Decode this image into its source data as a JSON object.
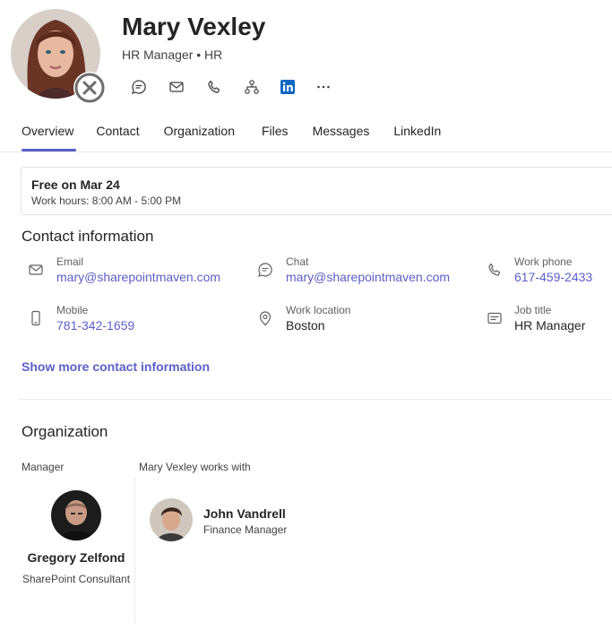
{
  "profile": {
    "name": "Mary Vexley",
    "subtitle": "HR Manager • HR",
    "presence": "offline-icon"
  },
  "actions": [
    {
      "icon": "chat-icon",
      "name": "chat-action-button"
    },
    {
      "icon": "mail-icon",
      "name": "email-action-button"
    },
    {
      "icon": "phone-icon",
      "name": "call-action-button"
    },
    {
      "icon": "org-chart-icon",
      "name": "org-action-button"
    },
    {
      "icon": "linkedin-icon",
      "name": "linkedin-action-button"
    },
    {
      "icon": "more-icon",
      "name": "more-actions-button"
    }
  ],
  "tabs": [
    {
      "label": "Overview",
      "selected": true
    },
    {
      "label": "Contact"
    },
    {
      "label": "Organization"
    },
    {
      "label": "Files"
    },
    {
      "label": "Messages"
    },
    {
      "label": "LinkedIn"
    }
  ],
  "availability": {
    "title": "Free on Mar 24",
    "hours": "Work hours: 8:00 AM - 5:00 PM"
  },
  "contact": {
    "title": "Contact information",
    "email": {
      "label": "Email",
      "value": "mary@sharepointmaven.com",
      "icon": "mail-icon"
    },
    "chat": {
      "label": "Chat",
      "value": "mary@sharepointmaven.com",
      "icon": "chat-icon"
    },
    "work_phone": {
      "label": "Work phone",
      "value": "617-459-2433",
      "icon": "phone-icon"
    },
    "mobile": {
      "label": "Mobile",
      "value": "781-342-1659",
      "icon": "mobile-icon"
    },
    "location": {
      "label": "Work location",
      "value": "Boston",
      "icon": "location-icon"
    },
    "job": {
      "label": "Job title",
      "value": "HR Manager",
      "icon": "id-card-icon"
    },
    "show_more": "Show more contact information"
  },
  "organization": {
    "title": "Organization",
    "manager_label": "Manager",
    "works_with_label": "Mary Vexley works with",
    "manager": {
      "name": "Gregory Zelfond",
      "title": "SharePoint Consultant"
    },
    "peer": {
      "name": "John Vandrell",
      "title": "Finance Manager"
    }
  },
  "colors": {
    "accent": "#5b5fc7",
    "linkedin": "#0a66c2",
    "text": "#242424",
    "secondary_text": "#616161"
  }
}
